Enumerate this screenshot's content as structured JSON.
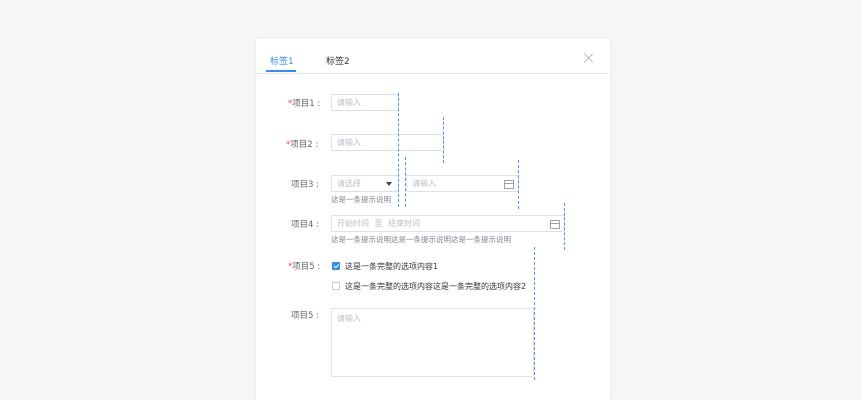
{
  "tabs": [
    {
      "label": "标签1",
      "active": true
    },
    {
      "label": "标签2",
      "active": false
    }
  ],
  "form": {
    "required_mark": "*",
    "item1": {
      "label": "项目1 :",
      "placeholder": "请输入"
    },
    "item2": {
      "label": "项目2 :",
      "placeholder": "请输入"
    },
    "item3": {
      "label": "项目3 :",
      "select_placeholder": "请选择",
      "input_placeholder": "请输入",
      "hint": "这是一条提示说明"
    },
    "item4": {
      "label": "项目4 :",
      "start_placeholder": "开始时间",
      "separator": "至",
      "end_placeholder": "结束时间",
      "hint": "这是一条提示说明这是一条提示说明这是一条提示说明"
    },
    "item5_check": {
      "label": "项目5 :",
      "options": [
        {
          "label": "这是一条完整的选项内容1",
          "checked": true
        },
        {
          "label": "这是一条完整的选项内容这是一条完整的选项内容2",
          "checked": false
        }
      ]
    },
    "item5_text": {
      "label": "项目5 :",
      "placeholder": "请输入"
    }
  },
  "colors": {
    "accent": "#3a8ee6",
    "required": "#f04b4b",
    "guide": "#4f93f0"
  },
  "icons": [
    "close-icon",
    "chevron-down-icon",
    "calendar-icon",
    "checkbox-icon"
  ]
}
